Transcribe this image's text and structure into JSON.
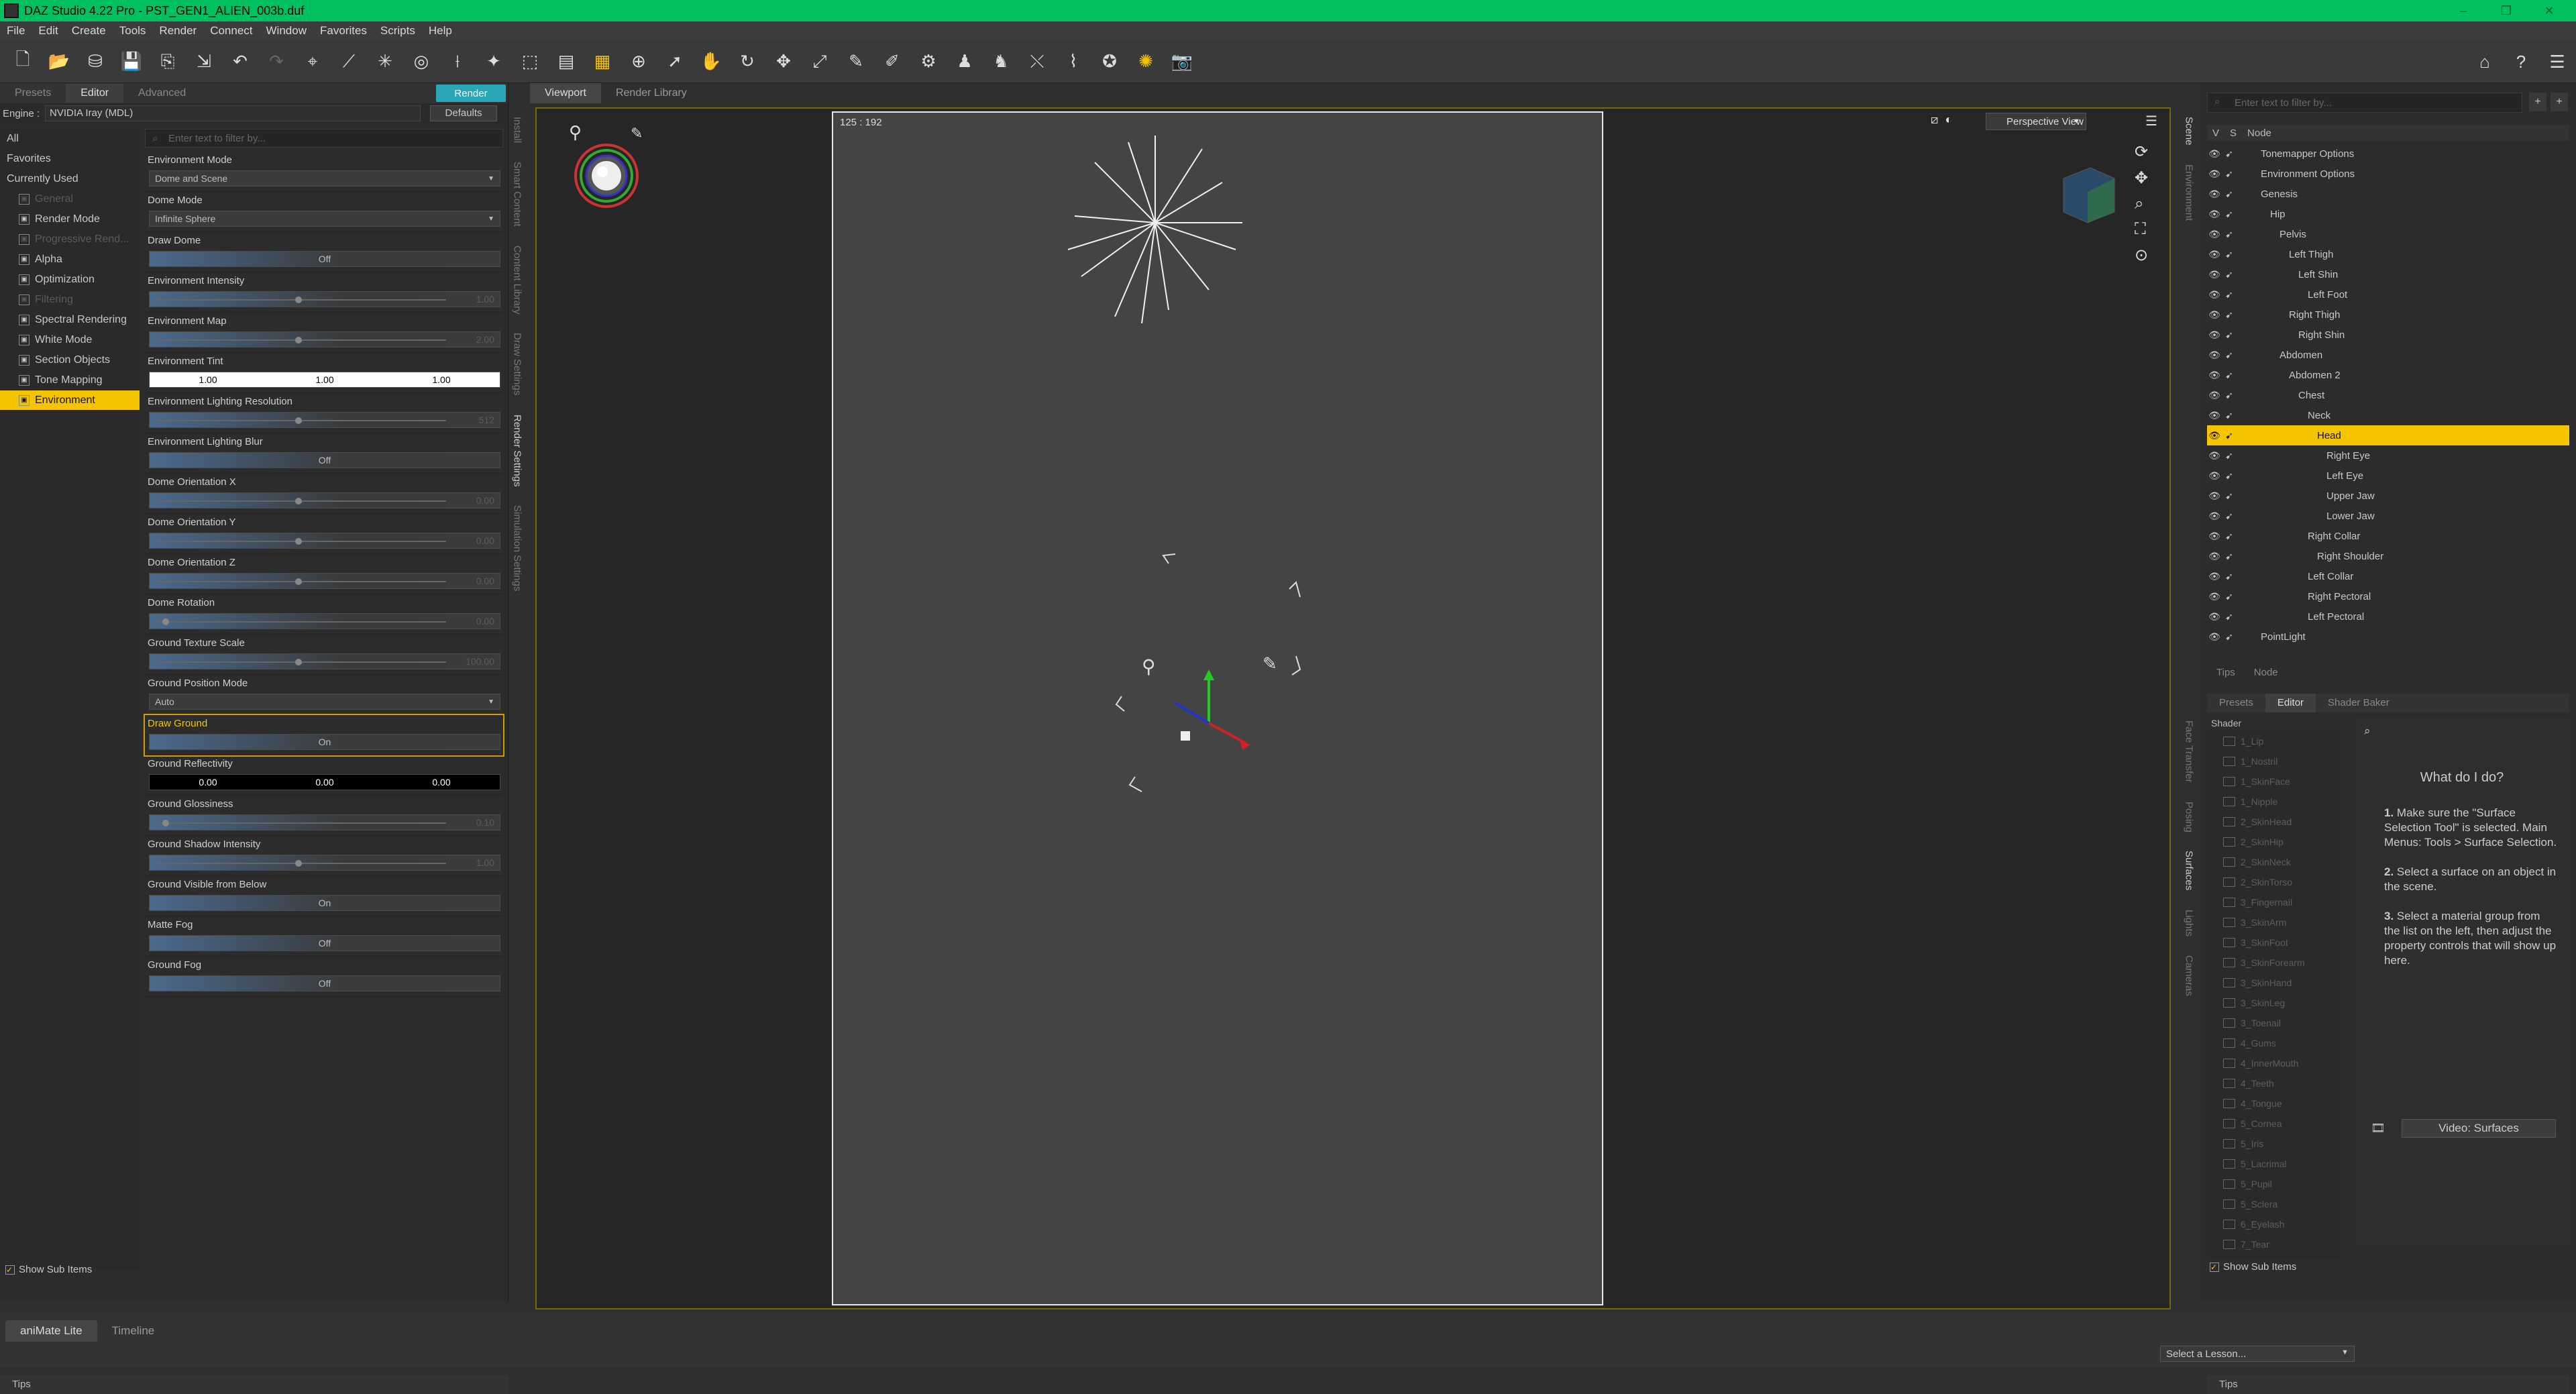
{
  "window": {
    "title": "DAZ Studio 4.22 Pro - PST_GEN1_ALIEN_003b.duf"
  },
  "menu": [
    "File",
    "Edit",
    "Create",
    "Tools",
    "Render",
    "Connect",
    "Window",
    "Favorites",
    "Scripts",
    "Help"
  ],
  "left_panel": {
    "tabs": [
      "Presets",
      "Editor",
      "Advanced"
    ],
    "render_label": "Render",
    "engine_label": "Engine :",
    "engine_value": "NVIDIA Iray (MDL)",
    "defaults_label": "Defaults",
    "filter_placeholder": "Enter text to filter by...",
    "categories": [
      {
        "label": "All",
        "grp": false,
        "dim": false
      },
      {
        "label": "Favorites",
        "grp": false,
        "dim": false
      },
      {
        "label": "Currently Used",
        "grp": false,
        "dim": false
      },
      {
        "label": "General",
        "grp": true,
        "dim": true
      },
      {
        "label": "Render Mode",
        "grp": true,
        "dim": false
      },
      {
        "label": "Progressive Rend...",
        "grp": true,
        "dim": true
      },
      {
        "label": "Alpha",
        "grp": true,
        "dim": false
      },
      {
        "label": "Optimization",
        "grp": true,
        "dim": false
      },
      {
        "label": "Filtering",
        "grp": true,
        "dim": true
      },
      {
        "label": "Spectral Rendering",
        "grp": true,
        "dim": false
      },
      {
        "label": "White Mode",
        "grp": true,
        "dim": false
      },
      {
        "label": "Section Objects",
        "grp": true,
        "dim": false
      },
      {
        "label": "Tone Mapping",
        "grp": true,
        "dim": false
      },
      {
        "label": "Environment",
        "grp": true,
        "dim": false,
        "selected": true
      }
    ],
    "properties": [
      {
        "label": "Environment Mode",
        "kind": "select",
        "value": "Dome and Scene"
      },
      {
        "label": "Dome Mode",
        "kind": "select",
        "value": "Infinite Sphere"
      },
      {
        "label": "Draw Dome",
        "kind": "toggle",
        "value": "Off"
      },
      {
        "label": "Environment Intensity",
        "kind": "slider",
        "value": "1.00",
        "pos": 0.47
      },
      {
        "label": "Environment Map",
        "kind": "slider",
        "value": "2.00",
        "pos": 0.47
      },
      {
        "label": "Environment Tint",
        "kind": "tint",
        "values": [
          "1.00",
          "1.00",
          "1.00"
        ]
      },
      {
        "label": "Environment Lighting Resolution",
        "kind": "slider",
        "value": "512",
        "pos": 0.47
      },
      {
        "label": "Environment Lighting Blur",
        "kind": "toggle",
        "value": "Off"
      },
      {
        "label": "Dome Orientation X",
        "kind": "slider",
        "value": "0.00",
        "pos": 0.47
      },
      {
        "label": "Dome Orientation Y",
        "kind": "slider",
        "value": "0.00",
        "pos": 0.47
      },
      {
        "label": "Dome Orientation Z",
        "kind": "slider",
        "value": "0.00",
        "pos": 0.47
      },
      {
        "label": "Dome Rotation",
        "kind": "slider",
        "value": "0.00",
        "pos": 0.02
      },
      {
        "label": "Ground Texture Scale",
        "kind": "slider",
        "value": "100.00",
        "pos": 0.47
      },
      {
        "label": "Ground Position Mode",
        "kind": "select",
        "value": "Auto"
      },
      {
        "label": "Draw Ground",
        "kind": "toggle",
        "value": "On",
        "highlight": true
      },
      {
        "label": "Ground Reflectivity",
        "kind": "refl",
        "values": [
          "0.00",
          "0.00",
          "0.00"
        ]
      },
      {
        "label": "Ground Glossiness",
        "kind": "slider",
        "value": "0.10",
        "pos": 0.02
      },
      {
        "label": "Ground Shadow Intensity",
        "kind": "slider",
        "value": "1.00",
        "pos": 0.47
      },
      {
        "label": "Ground Visible from Below",
        "kind": "toggle",
        "value": "On"
      },
      {
        "label": "Matte Fog",
        "kind": "toggle",
        "value": "Off"
      },
      {
        "label": "Ground Fog",
        "kind": "toggle",
        "value": "Off"
      }
    ],
    "show_sub_items": "Show Sub Items",
    "tips": "Tips"
  },
  "left_vtabs": [
    "Install",
    "Smart Content",
    "Content Library",
    "Draw Settings",
    "Render Settings",
    "Simulation Settings"
  ],
  "viewport": {
    "tabs": [
      "Viewport",
      "Render Library"
    ],
    "coords": "125 : 192",
    "view_mode": "Perspective View"
  },
  "right_vtabs_top": [
    "Scene",
    "Environment"
  ],
  "right_vtabs_bottom": [
    "Face Transfer",
    "Posing",
    "Surfaces",
    "Lights",
    "Cameras"
  ],
  "scene": {
    "filter_placeholder": "Enter text to filter by...",
    "header": [
      "V",
      "S",
      "Node"
    ],
    "nodes": [
      {
        "label": "Tonemapper Options",
        "depth": 0
      },
      {
        "label": "Environment Options",
        "depth": 0
      },
      {
        "label": "Genesis",
        "depth": 0
      },
      {
        "label": "Hip",
        "depth": 1
      },
      {
        "label": "Pelvis",
        "depth": 2
      },
      {
        "label": "Left Thigh",
        "depth": 3
      },
      {
        "label": "Left Shin",
        "depth": 4
      },
      {
        "label": "Left Foot",
        "depth": 5
      },
      {
        "label": "Right Thigh",
        "depth": 3
      },
      {
        "label": "Right Shin",
        "depth": 4
      },
      {
        "label": "Abdomen",
        "depth": 2
      },
      {
        "label": "Abdomen 2",
        "depth": 3
      },
      {
        "label": "Chest",
        "depth": 4
      },
      {
        "label": "Neck",
        "depth": 5
      },
      {
        "label": "Head",
        "depth": 6,
        "selected": true
      },
      {
        "label": "Right Eye",
        "depth": 7
      },
      {
        "label": "Left Eye",
        "depth": 7
      },
      {
        "label": "Upper Jaw",
        "depth": 7
      },
      {
        "label": "Lower Jaw",
        "depth": 7
      },
      {
        "label": "Right Collar",
        "depth": 5
      },
      {
        "label": "Right Shoulder",
        "depth": 6
      },
      {
        "label": "Left Collar",
        "depth": 5
      },
      {
        "label": "Right Pectoral",
        "depth": 5
      },
      {
        "label": "Left Pectoral",
        "depth": 5
      },
      {
        "label": "PointLight",
        "depth": 0
      }
    ],
    "tabs": [
      "Tips",
      "Node"
    ]
  },
  "surfaces": {
    "tabs": [
      "Presets",
      "Editor",
      "Shader Baker"
    ],
    "header": "Shader",
    "items": [
      "1_Lip",
      "1_Nostril",
      "1_SkinFace",
      "1_Nipple",
      "2_SkinHead",
      "2_SkinHip",
      "2_SkinNeck",
      "2_SkinTorso",
      "3_Fingernail",
      "3_SkinArm",
      "3_SkinFoot",
      "3_SkinForearm",
      "3_SkinHand",
      "3_SkinLeg",
      "3_Toenail",
      "4_Gums",
      "4_InnerMouth",
      "4_Teeth",
      "4_Tongue",
      "5_Cornea",
      "5_Iris",
      "5_Lacrimal",
      "5_Pupil",
      "5_Sclera",
      "6_Eyelash",
      "7_Tear"
    ],
    "show_sub_items": "Show Sub Items",
    "help_title": "What do I do?",
    "help_steps": [
      {
        "num": "1.",
        "text": "Make sure the \"Surface Selection Tool\" is selected. Main Menus: Tools > Surface Selection."
      },
      {
        "num": "2.",
        "text": "Select a surface on an object in the scene."
      },
      {
        "num": "3.",
        "text": "Select a material group from the list on the left, then adjust the property controls that will show up here."
      }
    ],
    "video_label": "Video: Surfaces",
    "tips": "Tips"
  },
  "bottom": {
    "tabs": [
      "aniMate Lite",
      "Timeline"
    ],
    "lesson": "Select a Lesson..."
  }
}
